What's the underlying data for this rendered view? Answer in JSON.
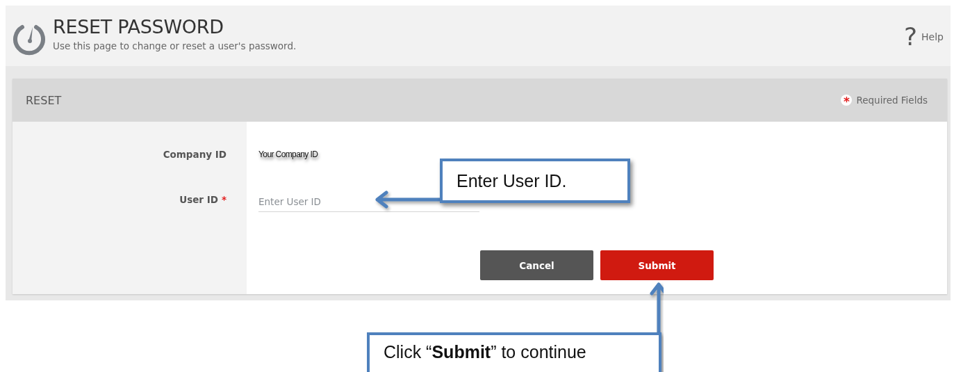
{
  "header": {
    "title": "RESET PASSWORD",
    "subtitle": "Use this page to change or reset a user's password.",
    "help_icon": "?",
    "help": "Help"
  },
  "card": {
    "title": "RESET",
    "required_mark": "*",
    "required_note": "Required Fields"
  },
  "fields": [
    {
      "kind": "static",
      "label": "Company ID",
      "value": "Your Company ID"
    },
    {
      "kind": "input",
      "label": "User ID",
      "required_mark": "*",
      "placeholder": "Enter User ID"
    }
  ],
  "buttons": [
    {
      "kind": "secondary",
      "label": "Cancel"
    },
    {
      "kind": "primary",
      "label": "Submit"
    }
  ],
  "callouts": [
    {
      "kind": "left-arrow",
      "text": "Enter User ID."
    },
    {
      "kind": "up-arrow",
      "text": "Click “**Submit**” to continue"
    }
  ]
}
